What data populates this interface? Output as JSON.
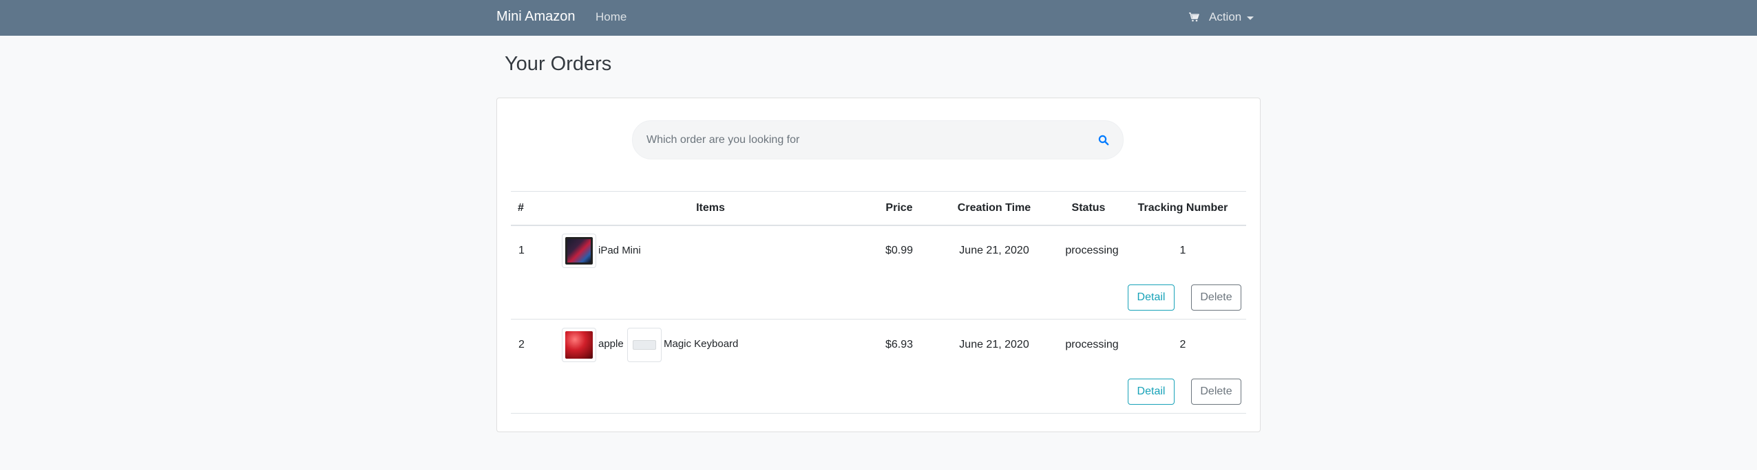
{
  "navbar": {
    "brand": "Mini Amazon",
    "home_label": "Home",
    "action_label": "Action",
    "cart_icon": "cart-icon",
    "background_color": "#5f768b"
  },
  "page": {
    "title": "Your Orders"
  },
  "search": {
    "placeholder": "Which order are you looking for",
    "icon": "search-icon",
    "icon_color": "#007bff"
  },
  "table": {
    "headers": {
      "number": "#",
      "items": "Items",
      "price": "Price",
      "creation_time": "Creation Time",
      "status": "Status",
      "tracking_number": "Tracking Number"
    },
    "rows": [
      {
        "number": "1",
        "items": [
          {
            "name": "iPad Mini",
            "image": "ipad-mini-thumbnail"
          }
        ],
        "price": "$0.99",
        "creation_time": "June 21, 2020",
        "status": "processing",
        "tracking_number": "1",
        "detail_label": "Detail",
        "delete_label": "Delete"
      },
      {
        "number": "2",
        "items": [
          {
            "name": "apple",
            "image": "apple-thumbnail"
          },
          {
            "name": "Magic Keyboard",
            "image": "magic-keyboard-thumbnail"
          }
        ],
        "price": "$6.93",
        "creation_time": "June 21, 2020",
        "status": "processing",
        "tracking_number": "2",
        "detail_label": "Detail",
        "delete_label": "Delete"
      }
    ]
  },
  "colors": {
    "detail_button": "#17a2b8",
    "delete_button": "#6c757d"
  }
}
